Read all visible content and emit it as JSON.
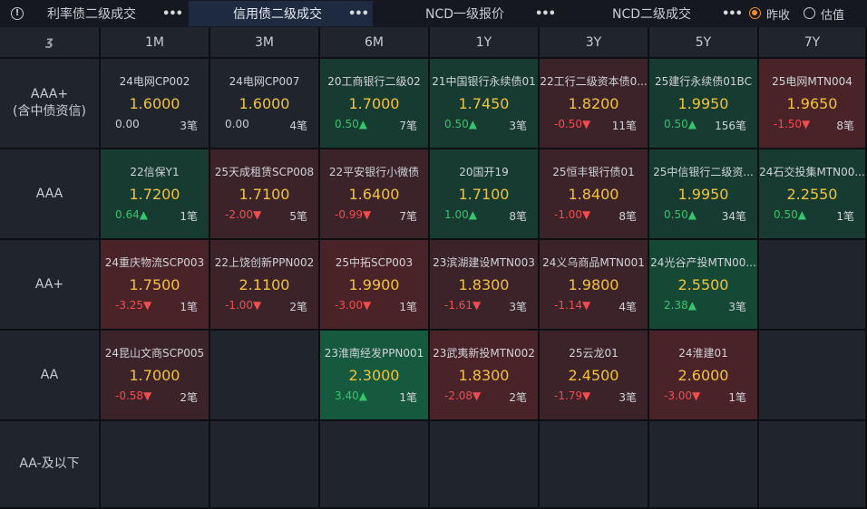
{
  "tabs": [
    {
      "label": "利率债二级成交",
      "active": false
    },
    {
      "label": "信用债二级成交",
      "active": true
    },
    {
      "label": "NCD一级报价",
      "active": false
    },
    {
      "label": "NCD二级成交",
      "active": false
    }
  ],
  "more_glyph": "•••",
  "info_glyph": "!",
  "radios": [
    {
      "label": "昨收",
      "checked": true
    },
    {
      "label": "估值",
      "checked": false
    }
  ],
  "corner_glyph": "ʒ",
  "columns": [
    "1M",
    "3M",
    "6M",
    "1Y",
    "3Y",
    "5Y",
    "7Y"
  ],
  "rows": [
    {
      "label_lines": [
        "AAA+",
        "(含中债资信)"
      ],
      "cells": [
        {
          "name": "24电网CP002",
          "price": "1.6000",
          "change": "0.00",
          "dir": "flat",
          "count": "3笔",
          "tone": "neutral"
        },
        {
          "name": "24电网CP007",
          "price": "1.6000",
          "change": "0.00",
          "dir": "flat",
          "count": "4笔",
          "tone": "neutral"
        },
        {
          "name": "20工商银行二级02",
          "price": "1.7000",
          "change": "0.50▲",
          "dir": "up",
          "count": "7笔",
          "tone": "green-light"
        },
        {
          "name": "21中国银行永续债01",
          "price": "1.7450",
          "change": "0.50▲",
          "dir": "up",
          "count": "3笔",
          "tone": "green-light"
        },
        {
          "name": "22工行二级资本债0...",
          "price": "1.8200",
          "change": "-0.50▼",
          "dir": "down",
          "count": "11笔",
          "tone": "red-light"
        },
        {
          "name": "25建行永续债01BC",
          "price": "1.9950",
          "change": "0.50▲",
          "dir": "up",
          "count": "156笔",
          "tone": "green-light"
        },
        {
          "name": "25电网MTN004",
          "price": "1.9650",
          "change": "-1.50▼",
          "dir": "down",
          "count": "8笔",
          "tone": "red-mid"
        }
      ]
    },
    {
      "label_lines": [
        "AAA"
      ],
      "cells": [
        {
          "name": "22信保Y1",
          "price": "1.7200",
          "change": "0.64▲",
          "dir": "up",
          "count": "1笔",
          "tone": "green-light"
        },
        {
          "name": "25天成租赁SCP008",
          "price": "1.7100",
          "change": "-2.00▼",
          "dir": "down",
          "count": "5笔",
          "tone": "red-light"
        },
        {
          "name": "22平安银行小微债",
          "price": "1.6400",
          "change": "-0.99▼",
          "dir": "down",
          "count": "7笔",
          "tone": "red-light"
        },
        {
          "name": "20国开19",
          "price": "1.7100",
          "change": "1.00▲",
          "dir": "up",
          "count": "8笔",
          "tone": "green-light"
        },
        {
          "name": "25恒丰银行债01",
          "price": "1.8400",
          "change": "-1.00▼",
          "dir": "down",
          "count": "8笔",
          "tone": "red-light"
        },
        {
          "name": "25中信银行二级资...",
          "price": "1.9950",
          "change": "0.50▲",
          "dir": "up",
          "count": "34笔",
          "tone": "green-light"
        },
        {
          "name": "24石交投集MTN00...",
          "price": "2.2550",
          "change": "0.50▲",
          "dir": "up",
          "count": "1笔",
          "tone": "green-light"
        }
      ]
    },
    {
      "label_lines": [
        "AA+"
      ],
      "cells": [
        {
          "name": "24重庆物流SCP003",
          "price": "1.7500",
          "change": "-3.25▼",
          "dir": "down",
          "count": "1笔",
          "tone": "red-mid"
        },
        {
          "name": "22上饶创新PPN002",
          "price": "2.1100",
          "change": "-1.00▼",
          "dir": "down",
          "count": "2笔",
          "tone": "red-light"
        },
        {
          "name": "25中拓SCP003",
          "price": "1.9900",
          "change": "-3.00▼",
          "dir": "down",
          "count": "1笔",
          "tone": "red-mid"
        },
        {
          "name": "23滨湖建设MTN003",
          "price": "1.8300",
          "change": "-1.61▼",
          "dir": "down",
          "count": "3笔",
          "tone": "red-light"
        },
        {
          "name": "24义乌商品MTN001",
          "price": "1.9800",
          "change": "-1.14▼",
          "dir": "down",
          "count": "4笔",
          "tone": "red-light"
        },
        {
          "name": "24光谷产投MTN00...",
          "price": "2.5500",
          "change": "2.38▲",
          "dir": "up",
          "count": "3笔",
          "tone": "green-mid"
        },
        null
      ]
    },
    {
      "label_lines": [
        "AA"
      ],
      "cells": [
        {
          "name": "24昆山文商SCP005",
          "price": "1.7000",
          "change": "-0.58▼",
          "dir": "down",
          "count": "2笔",
          "tone": "red-light"
        },
        null,
        {
          "name": "23淮南经发PPN001",
          "price": "2.3000",
          "change": "3.40▲",
          "dir": "up",
          "count": "1笔",
          "tone": "green-strong"
        },
        {
          "name": "23武夷新投MTN002",
          "price": "1.8300",
          "change": "-2.08▼",
          "dir": "down",
          "count": "2笔",
          "tone": "red-mid"
        },
        {
          "name": "25云龙01",
          "price": "2.4500",
          "change": "-1.79▼",
          "dir": "down",
          "count": "3笔",
          "tone": "red-light"
        },
        {
          "name": "24淮建01",
          "price": "2.6000",
          "change": "-3.00▼",
          "dir": "down",
          "count": "1笔",
          "tone": "red-mid"
        },
        null
      ]
    },
    {
      "label_lines": [
        "AA-及以下"
      ],
      "cells": [
        null,
        null,
        null,
        null,
        null,
        null,
        null
      ]
    }
  ]
}
